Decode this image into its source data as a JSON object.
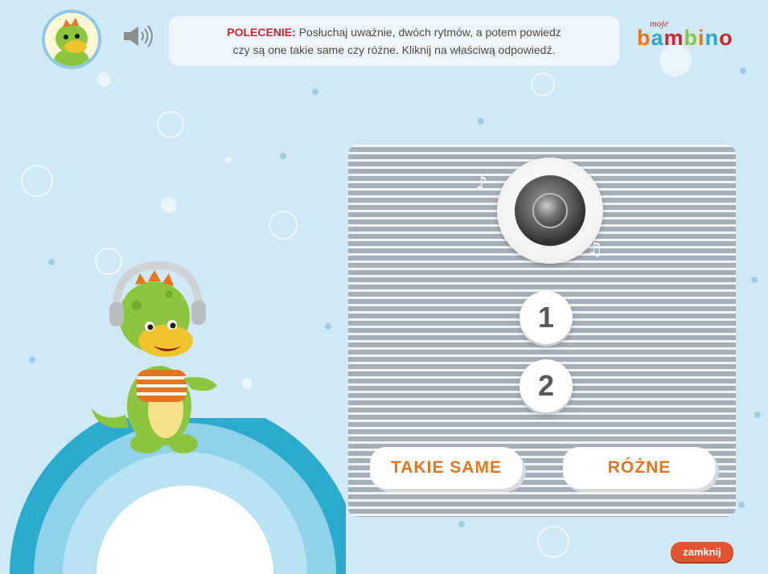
{
  "instruction": {
    "label": "POLECENIE:",
    "line1": "Posłuchaj uważnie, dwóch rytmów, a potem powiedz",
    "line2": "czy są one takie same czy różne. Kliknij na właściwą odpowiedź."
  },
  "logo": {
    "small": "moje",
    "big": "bambino"
  },
  "rhythm_buttons": [
    "1",
    "2"
  ],
  "answers": {
    "same": "TAKIE SAME",
    "different": "RÓŻNE"
  },
  "close_label": "zamknij",
  "icons": {
    "speaker": "speaker-icon",
    "play": "play-lens-icon",
    "note": "music-note-icon"
  },
  "colors": {
    "background": "#cfe9f7",
    "accent_red": "#d3252d",
    "answer_orange": "#e8741e",
    "close_button": "#e4532f"
  }
}
